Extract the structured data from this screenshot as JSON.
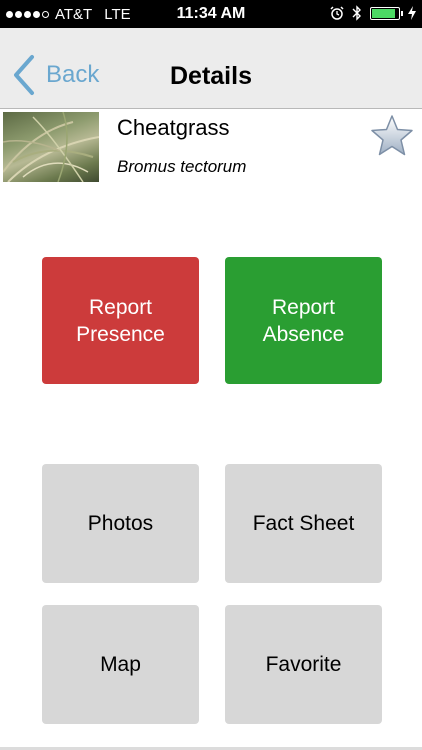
{
  "status_bar": {
    "carrier": "AT&T",
    "network": "LTE",
    "time": "11:34 AM",
    "signal_bars": 4,
    "signal_total": 5,
    "battery_level": 0.9,
    "battery_color": "#4cd964"
  },
  "navbar": {
    "back_label": "Back",
    "title": "Details",
    "back_icon": "chevron-left-icon"
  },
  "species": {
    "common_name": "Cheatgrass",
    "scientific_name": "Bromus tectorum",
    "favorite_icon": "star-icon"
  },
  "actions": {
    "report_presence": "Report\nPresence",
    "report_absence": "Report\nAbsence",
    "photos": "Photos",
    "fact_sheet": "Fact Sheet",
    "map": "Map",
    "favorite": "Favorite"
  },
  "colors": {
    "presence": "#cc3b3b",
    "absence": "#2a9e32",
    "neutral": "#d7d7d7",
    "accent": "#6aa7cf"
  }
}
